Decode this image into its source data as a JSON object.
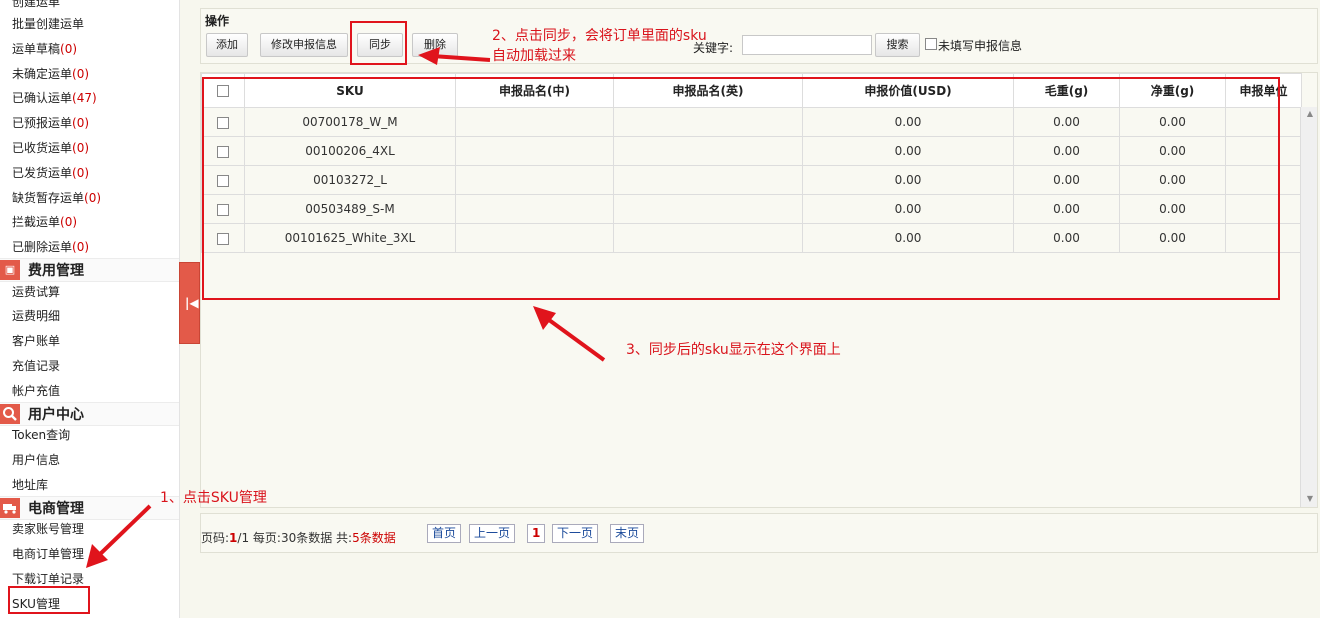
{
  "sidebar": {
    "items_top": [
      {
        "label": "创建运单",
        "count": ""
      },
      {
        "label": "批量创建运单",
        "count": ""
      },
      {
        "label": "运单草稿",
        "count": "(0)"
      },
      {
        "label": "未确定运单",
        "count": "(0)"
      },
      {
        "label": "已确认运单",
        "count": "(47)"
      },
      {
        "label": "已预报运单",
        "count": "(0)"
      },
      {
        "label": "已收货运单",
        "count": "(0)"
      },
      {
        "label": "已发货运单",
        "count": "(0)"
      },
      {
        "label": "缺货暂存运单",
        "count": "(0)"
      },
      {
        "label": "拦截运单",
        "count": "(0)"
      },
      {
        "label": "已删除运单",
        "count": "(0)"
      }
    ],
    "section_fee": {
      "title": "费用管理",
      "icon": "wallet-icon",
      "items": [
        "运费试算",
        "运费明细",
        "客户账单",
        "充值记录",
        "帐户充值"
      ]
    },
    "section_user": {
      "title": "用户中心",
      "icon": "search-icon",
      "items": [
        "Token查询",
        "用户信息",
        "地址库"
      ]
    },
    "section_ecom": {
      "title": "电商管理",
      "icon": "truck-icon",
      "items": [
        "卖家账号管理",
        "电商订单管理",
        "下载订单记录",
        "SKU管理"
      ]
    }
  },
  "operations": {
    "title": "操作",
    "add": "添加",
    "edit_declare": "修改申报信息",
    "sync": "同步",
    "delete": "删除",
    "keyword_label": "关键字:",
    "keyword_value": "",
    "search": "搜索",
    "unfilled_label": "未填写申报信息"
  },
  "table": {
    "headers": [
      "SKU",
      "申报品名(中)",
      "申报品名(英)",
      "申报价值(USD)",
      "毛重(g)",
      "净重(g)",
      "申报单位"
    ],
    "rows": [
      {
        "sku": "00700178_W_M",
        "name_cn": "",
        "name_en": "",
        "value": "0.00",
        "gross": "0.00",
        "net": "0.00",
        "unit": ""
      },
      {
        "sku": "00100206_4XL",
        "name_cn": "",
        "name_en": "",
        "value": "0.00",
        "gross": "0.00",
        "net": "0.00",
        "unit": ""
      },
      {
        "sku": "00103272_L",
        "name_cn": "",
        "name_en": "",
        "value": "0.00",
        "gross": "0.00",
        "net": "0.00",
        "unit": ""
      },
      {
        "sku": "00503489_S-M",
        "name_cn": "",
        "name_en": "",
        "value": "0.00",
        "gross": "0.00",
        "net": "0.00",
        "unit": ""
      },
      {
        "sku": "00101625_White_3XL",
        "name_cn": "",
        "name_en": "",
        "value": "0.00",
        "gross": "0.00",
        "net": "0.00",
        "unit": ""
      }
    ]
  },
  "pager": {
    "page_label": "页码:",
    "current_page": "1",
    "total_pages": "/1",
    "per_page": " 每页:30条数据 共:",
    "total": "5条数据",
    "first": "首页",
    "prev": "上一页",
    "page_num": "1",
    "next": "下一页",
    "last": "末页"
  },
  "annotations": {
    "step1": "1、点击SKU管理",
    "step2_line1": "2、点击同步，会将订单里面的sku",
    "step2_line2": "自动加载过来",
    "step3": "3、同步后的sku显示在这个界面上",
    "color": "#e0141c"
  },
  "colors": {
    "accent": "#e35a49",
    "count_red": "#cc0000",
    "link_blue": "#1a4a9a"
  }
}
